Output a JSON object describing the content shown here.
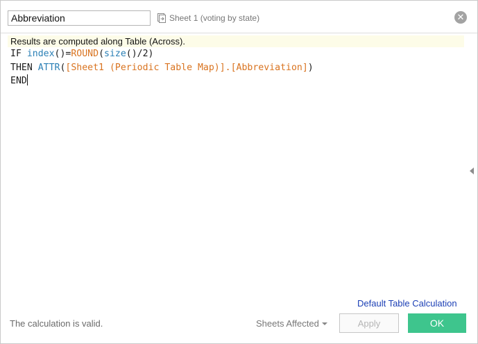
{
  "header": {
    "name_value": "Abbreviation",
    "source_sheet": "Sheet 1 (voting by state)",
    "source_icon": "sheet-link-icon",
    "close_icon": "close-icon",
    "close_glyph": "✕"
  },
  "editor": {
    "notice": "Results are computed along Table (Across).",
    "line1": {
      "t1": "IF ",
      "t2": "index",
      "t3": "()=",
      "t4": "ROUND",
      "t5": "(",
      "t6": "size",
      "t7": "()/2)"
    },
    "line2": {
      "t1": "THEN ",
      "t2": "ATTR",
      "t3": "(",
      "t4": "[Sheet1 (Periodic Table Map)].[Abbreviation]",
      "t5": ")"
    },
    "line3": {
      "t1": "END"
    }
  },
  "footer": {
    "default_link": "Default Table Calculation",
    "status": "The calculation is valid.",
    "sheets_affected": "Sheets Affected",
    "apply": "Apply",
    "ok": "OK"
  },
  "colors": {
    "function": "#2a7fb5",
    "field": "#d9731f",
    "ok_button": "#3ec58d",
    "link": "#1b3fb5",
    "notice_bg": "#fdfce8"
  }
}
